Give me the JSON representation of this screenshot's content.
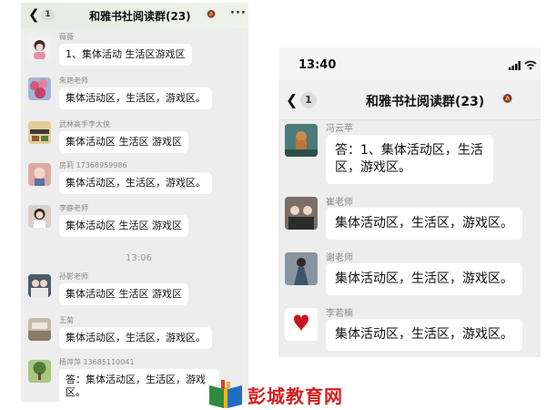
{
  "left_chat": {
    "title": "和雅书社阅读群(23)",
    "unread_badge": "1",
    "messages": [
      {
        "sender": "薇薇",
        "text": "1、集体活动  生活区游戏区"
      },
      {
        "sender": "朱艳老师",
        "text": "集体活动区，生活区，游戏区。"
      },
      {
        "sender": "武林高手李大侠",
        "text": "集体活动区   生活区   游戏区"
      },
      {
        "sender": "房莉 17368959986",
        "text": "集体活动区，生活区，游戏区。"
      },
      {
        "sender": "李静老师",
        "text": "集体活动区   生活区   游戏区"
      },
      {
        "sender": "孙影老师",
        "text": "集体活动区   生活区  游戏区"
      },
      {
        "sender": "王菊",
        "text": "集体活动区，生活区，游戏区。"
      },
      {
        "sender": "杨萍萍 13685110041",
        "text": "答：集体活动区，生活区，游戏区。"
      }
    ],
    "timestamp": "13:06"
  },
  "right_chat": {
    "time": "13:40",
    "title": "和雅书社阅读群(23)",
    "unread_badge": "1",
    "messages": [
      {
        "sender": "冯云苹",
        "text": "答：1、集体活动区，生活区，游戏区。"
      },
      {
        "sender": "崔老师",
        "text": "集体活动区，生活区，游戏区。"
      },
      {
        "sender": "谢老师",
        "text": "集体活动区，生活区，游戏区。"
      },
      {
        "sender": "李若楠",
        "text": "集体活动区，生活区，游戏区。"
      }
    ]
  },
  "watermark": {
    "text": "彭城教育网"
  },
  "icons": {
    "back": "chevron-left-icon",
    "mute": "mute-bell-icon",
    "more": "more-dots-icon",
    "signal": "cellular-signal-icon",
    "wifi": "wifi-icon",
    "battery": "battery-icon",
    "logo": "book-logo-icon"
  },
  "colors": {
    "chat_background": "#ededed",
    "bubble": "#ffffff",
    "watermark_red": "#d81e1e"
  }
}
